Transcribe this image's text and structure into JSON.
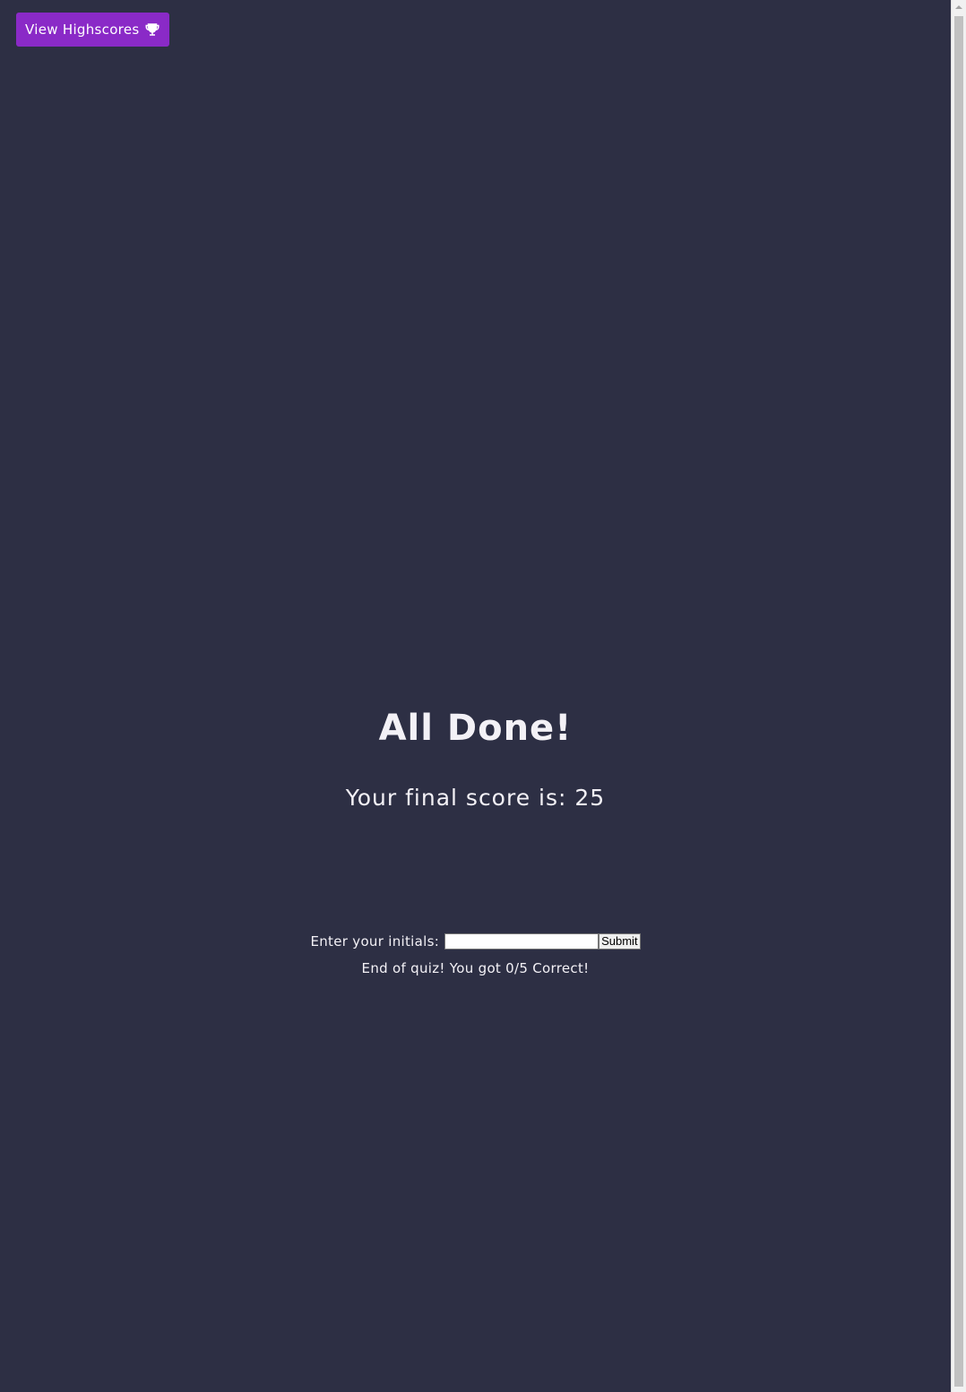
{
  "header": {
    "highscores_label": "View Highscores",
    "highscores_icon": "trophy-icon"
  },
  "result": {
    "title": "All Done!",
    "final_score_text": "Your final score is: 25",
    "initials_label": "Enter your initials:",
    "initials_value": "",
    "initials_placeholder": "",
    "submit_label": "Submit",
    "message": "End of quiz! You got 0/5 Correct!"
  },
  "colors": {
    "background": "#2d2f44",
    "accent": "#8a2ac7",
    "text": "#f3f1f6"
  }
}
